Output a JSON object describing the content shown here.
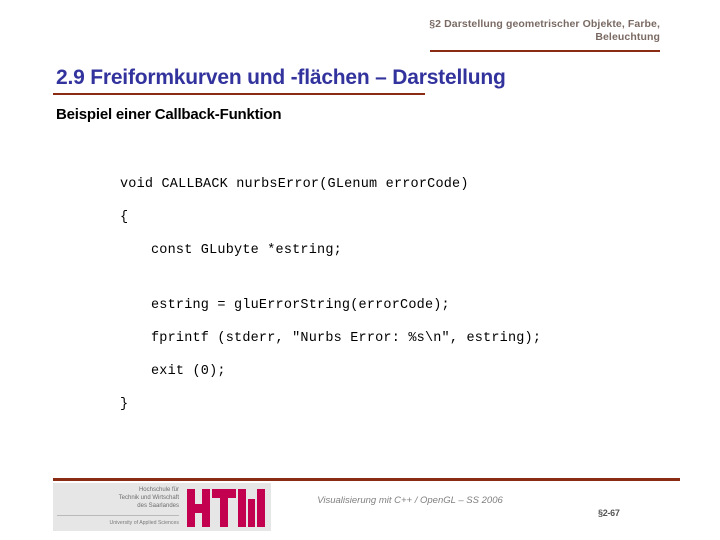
{
  "header": {
    "line1": "§2 Darstellung geometrischer Objekte, Farbe,",
    "line2": "Beleuchtung",
    "rule_color": "#8a2b14",
    "text_color": "#7a6a63"
  },
  "title": {
    "text": "2.9 Freiformkurven und -flächen – Darstellung",
    "color": "#33339e",
    "rule_color": "#8a2b14"
  },
  "subtitle": {
    "text": "Beispiel einer Callback-Funktion"
  },
  "code": {
    "lines": [
      {
        "text": "void CALLBACK nurbsError(GLenum errorCode)",
        "indent": 0,
        "blank": false
      },
      {
        "text": "{",
        "indent": 0,
        "blank": false
      },
      {
        "text": "const GLubyte *estring;",
        "indent": 1,
        "blank": false
      },
      {
        "text": "",
        "indent": 0,
        "blank": true
      },
      {
        "text": "estring = gluErrorString(errorCode);",
        "indent": 1,
        "blank": false
      },
      {
        "text": "fprintf (stderr, \"Nurbs Error: %s\\n\", estring);",
        "indent": 1,
        "blank": false
      },
      {
        "text": "exit (0);",
        "indent": 1,
        "blank": false
      },
      {
        "text": "}",
        "indent": 0,
        "blank": false
      }
    ]
  },
  "footer": {
    "rule_color": "#8a2b14",
    "logo": {
      "line1": "Hochschule für",
      "line2": "Technik und Wirtschaft",
      "line3": "des Saarlandes",
      "line4": "University of Applied Sciences",
      "monogram": "HTW",
      "mark_color": "#c2004f",
      "background": "#e6e6e6"
    },
    "course_text": "Visualisierung mit C++ / OpenGL – SS 2006",
    "page_number": "§2-67"
  }
}
